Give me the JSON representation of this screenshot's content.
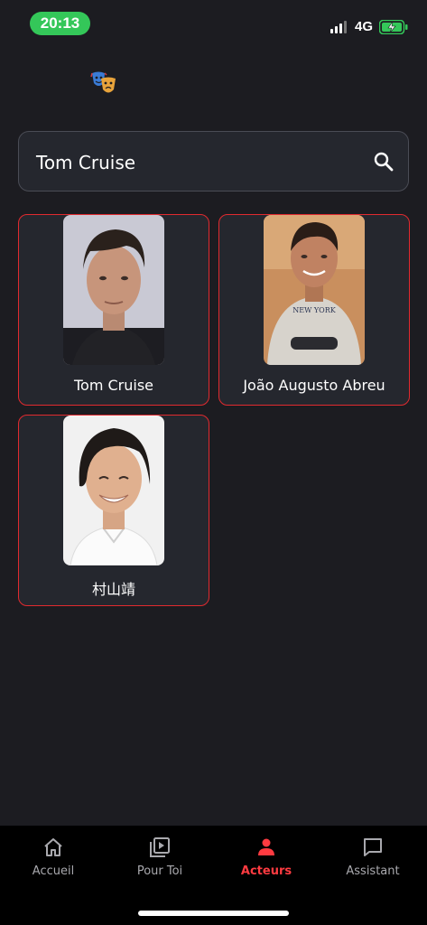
{
  "status_bar": {
    "time": "20:13",
    "network": "4G"
  },
  "search": {
    "value": "Tom Cruise"
  },
  "results": [
    {
      "name": "Tom Cruise"
    },
    {
      "name": "João Augusto Abreu"
    },
    {
      "name": "村山靖"
    }
  ],
  "nav": {
    "items": [
      {
        "label": "Accueil",
        "icon": "home-icon"
      },
      {
        "label": "Pour Toi",
        "icon": "video-library-icon"
      },
      {
        "label": "Acteurs",
        "icon": "person-icon"
      },
      {
        "label": "Assistant",
        "icon": "chat-icon"
      }
    ],
    "active": "Acteurs",
    "active_color": "#ff3b41"
  },
  "colors": {
    "accent": "#e12a2f",
    "background": "#1c1c21",
    "card": "#25272e"
  }
}
